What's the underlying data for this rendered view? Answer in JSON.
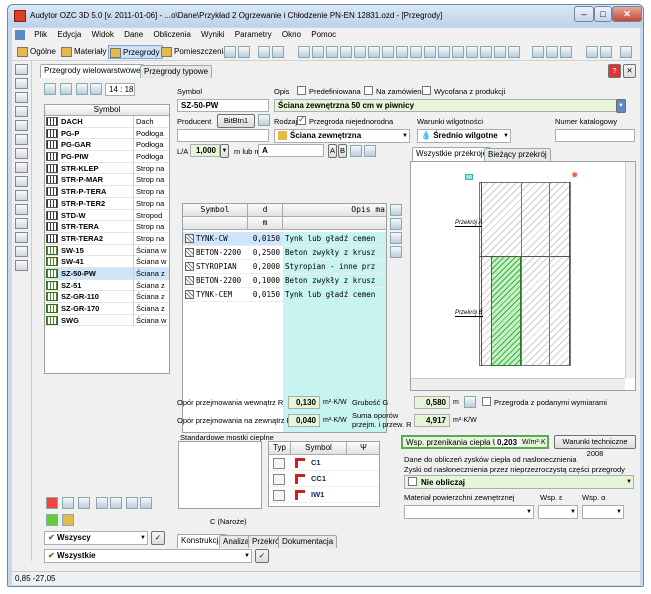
{
  "window": {
    "title": "Audytor OZC 3D 5.0  [v. 2011-01-06] - ...o\\Dane\\Przykład 2 Ogrzewanie i Chłodzenie PN-EN 12831.ozd - [Przegrody]"
  },
  "menu": [
    "Plik",
    "Edycja",
    "Widok",
    "Dane",
    "Obliczenia",
    "Wyniki",
    "Parametry",
    "Okno",
    "Pomoc"
  ],
  "toolbar": {
    "ogolne": "Ogólne",
    "materialy": "Materiały",
    "przegrody": "Przegrody",
    "pomieszczenia": "Pomieszczenia"
  },
  "tabs": {
    "wielowarstwowe": "Przegrody wielowarstwowe",
    "typowe": "Przegrody typowe"
  },
  "left": {
    "count": "14 : 18",
    "col_symbol": "Symbol",
    "rows": [
      {
        "symbol": "DACH",
        "type": "Dach"
      },
      {
        "symbol": "PG-P",
        "type": "Podłoga"
      },
      {
        "symbol": "PG-GAR",
        "type": "Podłoga"
      },
      {
        "symbol": "PG-PIW",
        "type": "Podłoga"
      },
      {
        "symbol": "STR-KLEP",
        "type": "Strop na"
      },
      {
        "symbol": "STR-P-MAR",
        "type": "Strop na"
      },
      {
        "symbol": "STR-P-TERA",
        "type": "Strop na"
      },
      {
        "symbol": "STR-P-TER2",
        "type": "Strop na"
      },
      {
        "symbol": "STD-W",
        "type": "Stropod"
      },
      {
        "symbol": "STR-TERA",
        "type": "Strop na"
      },
      {
        "symbol": "STR-TERA2",
        "type": "Strop na"
      },
      {
        "symbol": "SW-15",
        "type": "Ściana w"
      },
      {
        "symbol": "SW-41",
        "type": "Ściana w"
      },
      {
        "symbol": "SZ-50-PW",
        "type": "Ściana z"
      },
      {
        "symbol": "SZ-51",
        "type": "Ściana z"
      },
      {
        "symbol": "SZ-GR-110",
        "type": "Ściana z"
      },
      {
        "symbol": "SZ-GR-170",
        "type": "Ściana z"
      },
      {
        "symbol": "SWG",
        "type": "Ściana w"
      }
    ],
    "filter1": "Wszyscy",
    "filter2": "Wszystkie"
  },
  "form": {
    "symbol_lbl": "Symbol",
    "symbol": "SZ-50-PW",
    "opis_lbl": "Opis",
    "opis": "Ściana zewnętrzna 50 cm w piwnicy",
    "predef": "Predefiniowana",
    "zamow": "Na zamówienie",
    "wycof": "Wycofana z produkcji",
    "producent_lbl": "Producent",
    "btn": "BitBtn1",
    "rodzaj_lbl": "Rodzaj",
    "niejednorodna": "Przegroda niejednorodna",
    "rodzaj": "Ściana zewnętrzna",
    "wilg_lbl": "Warunki wilgotności",
    "wilg": "Średnio wilgotne",
    "katalog_lbl": "Numer katalogowy",
    "la_lbl": "L/A",
    "la": "1,000",
    "la_unit": "m lub m",
    "la_sel": "A",
    "cols": {
      "symbol": "Symbol",
      "d": "d",
      "opis": "Opis ma",
      "unit": "m"
    },
    "layers": [
      {
        "symbol": "TYNK-CW",
        "d": "0,0150",
        "opis": "Tynk lub gładź cemen"
      },
      {
        "symbol": "BETON-2200",
        "d": "0,2500",
        "opis": "Beton zwykły z krusz"
      },
      {
        "symbol": "STYROPIAN",
        "d": "0,2000",
        "opis": "Styropian - inne prz"
      },
      {
        "symbol": "BETON-2200",
        "d": "0,1000",
        "opis": "Beton zwykły z krusz"
      },
      {
        "symbol": "TYNK-CEM",
        "d": "0,0150",
        "opis": "Tynk lub gładź cemen"
      }
    ],
    "rsi_lbl": "Opór przejmowania wewnątrz R",
    "rsi": "0,130",
    "rse_lbl": "Opór przejmowania na zewnątrz R",
    "rse": "0,040",
    "runit": "m²·K/W",
    "grub_lbl": "Grubość G",
    "grub": "0,580",
    "grub_unit": "m",
    "suma_lbl1": "Suma oporów",
    "suma_lbl2": "przejm. i przew. R",
    "suma": "4,917",
    "podane": "Przegroda z podanymi wymiarami",
    "mostki_lbl": "Standardowe mostki cieplne",
    "mostki_cols": {
      "typ": "Typ",
      "symbol": "Symbol",
      "psi": "Ψ"
    },
    "mostki": [
      "C1",
      "CC1",
      "IW1"
    ],
    "naroze": "C (Naroże)",
    "u_lbl": "Wsp. przenikania ciepła U",
    "u": "0,203",
    "u_unit": "W/m²·K",
    "wt": "Warunki techniczne 2008",
    "zyski_lbl": "Dane do obliczeń zysków ciepła od nasłonecznienia",
    "zyski_sub": "Zyski od nasłonecznienia przez nieprzezroczystą części przegrody",
    "nie": "Nie obliczaj",
    "mat_lbl": "Materiał powierzchni zewnętrznej",
    "wspe": "Wsp. ε",
    "wspa": "Wsp. α"
  },
  "preview": {
    "tab1": "Wszystkie przekroje",
    "tab2": "Bieżący przekrój",
    "a": "Przekrój A",
    "b": "Przekrój B"
  },
  "bottom_tabs": [
    "Konstrukcja",
    "Analiza",
    "Przekrój",
    "Dokumentacja"
  ],
  "status": "0,85  -27,05"
}
